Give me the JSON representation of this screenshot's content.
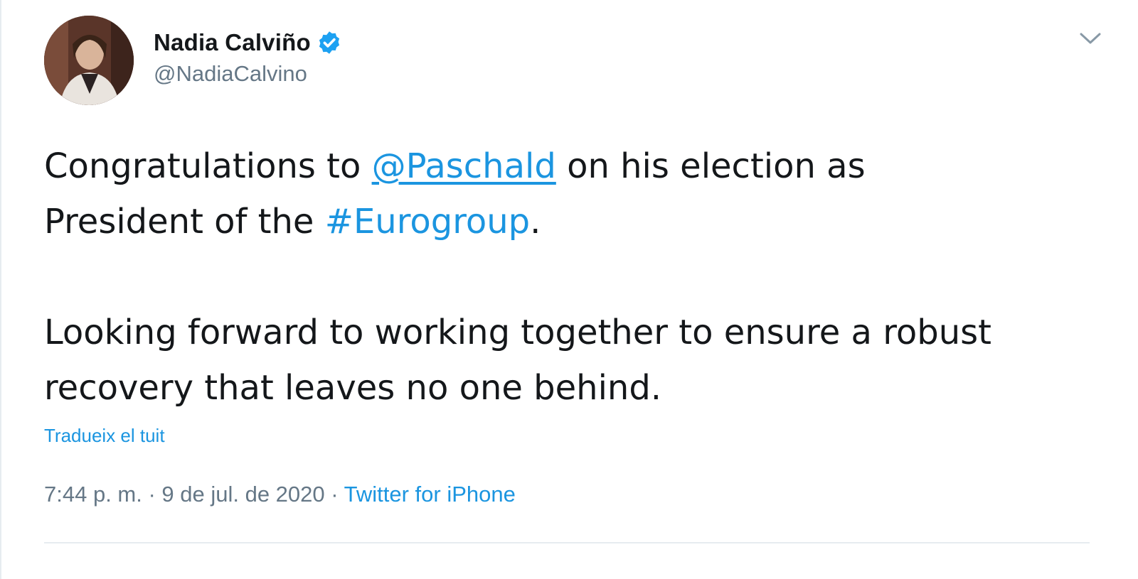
{
  "tweet": {
    "author": {
      "display_name": "Nadia Calviño",
      "handle": "@NadiaCalvino",
      "verified": true,
      "avatar_icon": "profile-photo"
    },
    "menu_icon": "chevron-down-icon",
    "text": {
      "line1_prefix": "Congratulations to ",
      "mention": "@Paschald",
      "line1_suffix": " on his election as",
      "line2_prefix": "President of the ",
      "hashtag": "#Eurogroup",
      "line2_suffix": ".",
      "paragraph2": "Looking forward to working together to ensure a robust recovery that leaves no one behind."
    },
    "translate_label": "Tradueix el tuit",
    "timestamp": "7:44 p. m. · 9 de jul. de 2020",
    "separator": " · ",
    "source": "Twitter for iPhone"
  },
  "colors": {
    "link": "#1b95e0",
    "text": "#14171a",
    "secondary_text": "#657786",
    "divider": "#e6ecf0"
  }
}
